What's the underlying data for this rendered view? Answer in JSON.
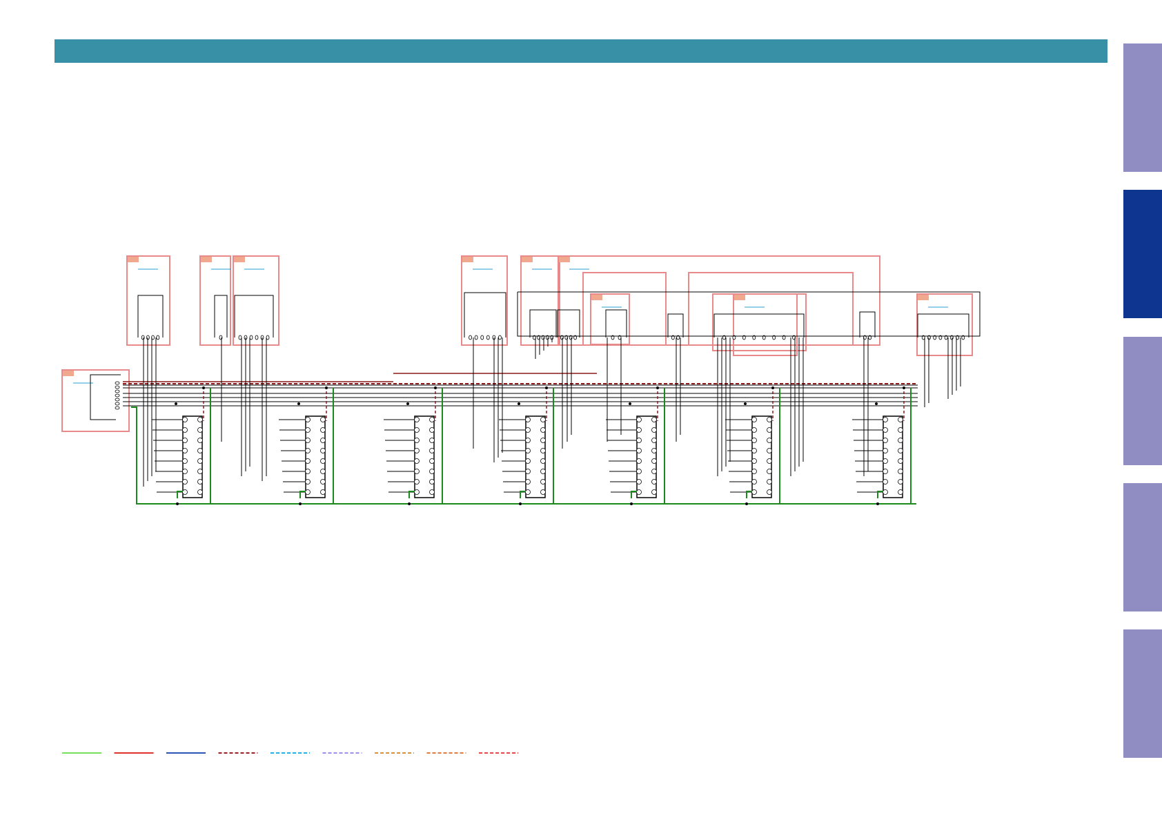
{
  "header": {
    "color": "#3890a6"
  },
  "side_tabs": [
    {
      "id": "tab-1",
      "active": false
    },
    {
      "id": "tab-2",
      "active": true
    },
    {
      "id": "tab-3",
      "active": false
    },
    {
      "id": "tab-4",
      "active": false
    },
    {
      "id": "tab-5",
      "active": false
    }
  ],
  "colors": {
    "tab": "#8f8dc2",
    "tab_active": "#0e3590",
    "block_border": "#e88a8a",
    "block_tag": "#f0a88e",
    "underline": "#2a9fd6",
    "wire": "#000000",
    "ground": "#1a8a1a",
    "power_dashed": "#8a1a1a"
  },
  "legend": [
    {
      "name": "legend-green-solid",
      "color": "#77e05a",
      "style": "solid"
    },
    {
      "name": "legend-red-solid",
      "color": "#e0312a",
      "style": "solid"
    },
    {
      "name": "legend-blue-solid",
      "color": "#2854b8",
      "style": "solid"
    },
    {
      "name": "legend-darkred-dashed",
      "color": "#9e1e24",
      "style": "dashed"
    },
    {
      "name": "legend-cyan-dashed",
      "color": "#2aaee0",
      "style": "dashed"
    },
    {
      "name": "legend-lavender-dashed",
      "color": "#9a8ee8",
      "style": "dashed"
    },
    {
      "name": "legend-orange-dashed",
      "color": "#e0902a",
      "style": "dashed"
    },
    {
      "name": "legend-orange2-dashed",
      "color": "#e07a3a",
      "style": "dashed"
    },
    {
      "name": "legend-red-dashed",
      "color": "#e04a4a",
      "style": "dashed"
    }
  ]
}
